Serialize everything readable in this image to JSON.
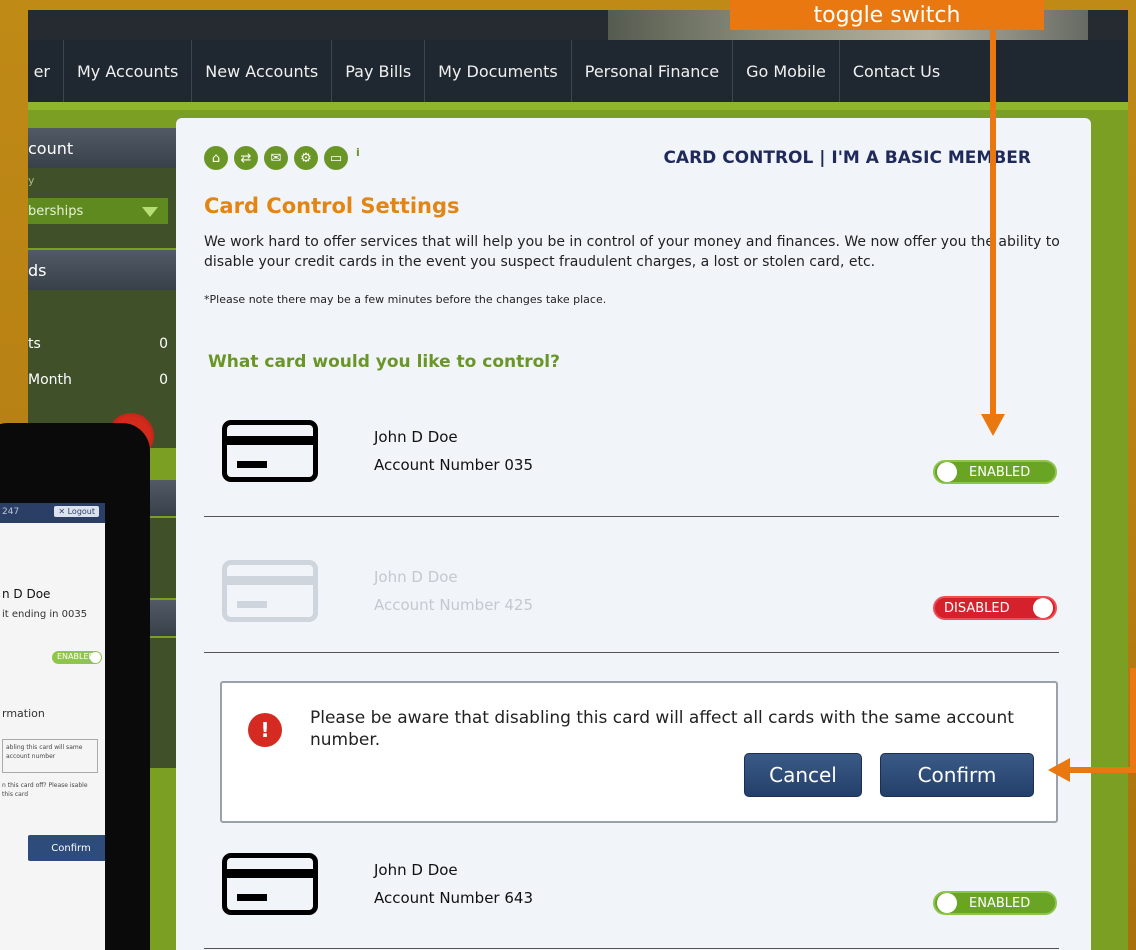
{
  "annotation": {
    "label": "toggle switch"
  },
  "nav": {
    "items": [
      "er",
      "My Accounts",
      "New Accounts",
      "Pay Bills",
      "My Documents",
      "Personal Finance",
      "Go Mobile",
      "Contact Us"
    ]
  },
  "sidebar": {
    "head1": "count",
    "small": "y",
    "select_value": "berships",
    "head2": "ds",
    "row1_label": "ts",
    "row1_value": "0",
    "row2_label": "Month",
    "row2_value": "0"
  },
  "main": {
    "header": "CARD CONTROL | I'M A BASIC MEMBER",
    "title": "Card Control Settings",
    "intro": "We work hard to offer services that will help you be in control of your money and finances. We now offer you the ability to disable your credit cards in the event you suspect fraudulent charges, a lost or stolen card, etc.",
    "note": "*Please note there may be a few minutes before the changes take place.",
    "question": "What card would you like to control?",
    "info_mark": "i",
    "cards": [
      {
        "name": "John D Doe",
        "account": "Account Number 035",
        "status": "ENABLED"
      },
      {
        "name": "John D Doe",
        "account": "Account Number 425",
        "status": "DISABLED"
      },
      {
        "name": "John D Doe",
        "account": "Account Number 643",
        "status": "ENABLED"
      }
    ],
    "warning": {
      "icon": "!",
      "text": "Please be aware that disabling this card will affect all cards with the same account number.",
      "cancel": "Cancel",
      "confirm": "Confirm"
    }
  },
  "phone": {
    "bar_left": "247",
    "bar_right": "✕ Logout",
    "name": "n D Doe",
    "credit": "it ending in 0035",
    "toggle": "ENABLED",
    "info": "rmation",
    "box_text": "abling this card will same account number",
    "question": "n this card off? Please isable this card",
    "confirm": "Confirm"
  },
  "colors": {
    "accent_green": "#6a9625",
    "title_orange": "#e38512",
    "annotation_orange": "#e97810",
    "enabled_green": "#6aa425",
    "disabled_red": "#d5212b",
    "button_navy": "#23406a"
  }
}
